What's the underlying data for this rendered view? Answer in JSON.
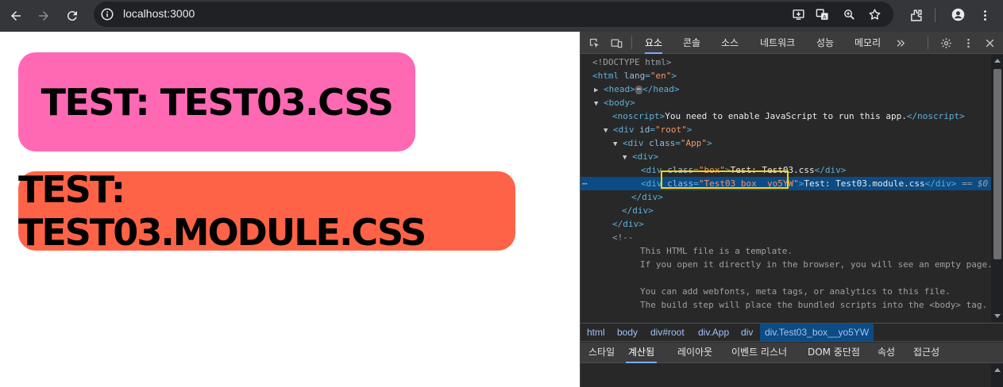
{
  "browser": {
    "url": "localhost:3000",
    "icons": [
      "back-icon",
      "forward-icon",
      "reload-icon",
      "info-icon",
      "install-app-icon",
      "translate-icon",
      "zoom-icon",
      "bookmark-star-icon",
      "extensions-icon",
      "profile-icon",
      "menu-icon"
    ]
  },
  "page": {
    "box_global_text": "Test: Test03.css",
    "box_module_text": "Test: Test03.module.css",
    "box_global_color": "#ff69b4",
    "box_module_color": "#ff6347"
  },
  "devtools": {
    "tabs": [
      "요소",
      "콘솔",
      "소스",
      "네트워크",
      "성능",
      "메모리"
    ],
    "active_tab": "요소",
    "dom": {
      "doctype": "<!DOCTYPE html>",
      "html_open": "<html",
      "html_lang_attr": "lang",
      "html_lang_val": "\"en\"",
      "head_open": "<head>",
      "head_ellipsis": "⋯",
      "head_close": "</head>",
      "body_open": "<body>",
      "noscript_open": "<noscript>",
      "noscript_text": "You need to enable JavaScript to run this app.",
      "noscript_close": "</noscript>",
      "div_open": "<div",
      "id_attr": "id",
      "root_val": "\"root\"",
      "class_attr": "class",
      "app_val": "\"App\"",
      "plain_div": "<div>",
      "box_val": "\"box\"",
      "box_text": "Test: Test03.css",
      "module_val": "\"Test03_box__yo5YW\"",
      "module_text": "Test: Test03.module.css",
      "div_close": "</div>",
      "dollar": "== $0",
      "comment_open": "<!--",
      "comment_lines": [
        "This HTML file is a template.",
        "If you open it directly in the browser, you will see an empty page.",
        "",
        "You can add webfonts, meta tags, or analytics to this file.",
        "The build step will place the bundled scripts into the <body> tag."
      ]
    },
    "breadcrumbs": [
      "html",
      "body",
      "div#root",
      "div.App",
      "div",
      "div.Test03_box__yo5YW"
    ],
    "subtabs": [
      "스타일",
      "계산됨",
      "레이아웃",
      "이벤트 리스너",
      "DOM 중단점",
      "속성",
      "접근성"
    ],
    "active_subtab": "계산됨",
    "highlight_color": "#ffd600"
  }
}
